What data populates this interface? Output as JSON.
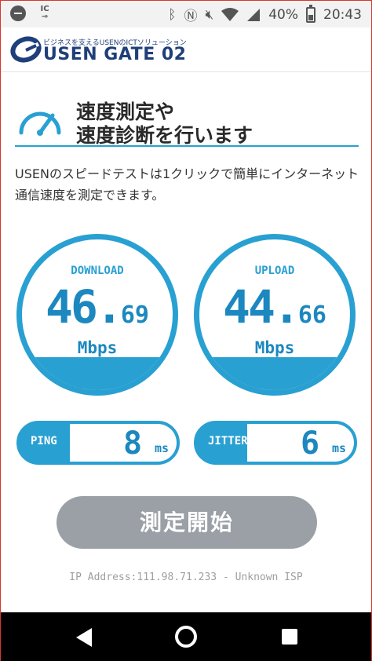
{
  "status_bar": {
    "icons_left": [
      "do-not-disturb-icon",
      "ic-card-key-icon"
    ],
    "ic_text": "IC",
    "icons_right": [
      "bluetooth-icon",
      "nfc-icon",
      "mute-icon",
      "wifi-icon",
      "signal-icon",
      "battery-icon"
    ],
    "battery": "40%",
    "time": "20:43"
  },
  "header": {
    "tagline": "ビジネスを支えるUSENのICTソリューション",
    "brand": "USEN GATE 02"
  },
  "title": {
    "line1": "速度測定や",
    "line2": "速度診断を行います"
  },
  "description": "USENのスピードテストは1クリックで簡単にインターネット通信速度を測定できます。",
  "download": {
    "label": "DOWNLOAD",
    "value_int": "46.",
    "value_dec": "69",
    "unit": "Mbps"
  },
  "upload": {
    "label": "UPLOAD",
    "value_int": "44.",
    "value_dec": "66",
    "unit": "Mbps"
  },
  "ping": {
    "label": "PING",
    "value": "8",
    "unit": "ms"
  },
  "jitter": {
    "label": "JITTER",
    "value": "6",
    "unit": "ms"
  },
  "start_button": "測定開始",
  "ip_info": "IP Address:111.98.71.233 - Unknown ISP",
  "colors": {
    "accent": "#29a0d2",
    "accent_dark": "#1c88bf",
    "button_disabled": "#9aa0a6",
    "brand_navy": "#1f3f7a"
  }
}
